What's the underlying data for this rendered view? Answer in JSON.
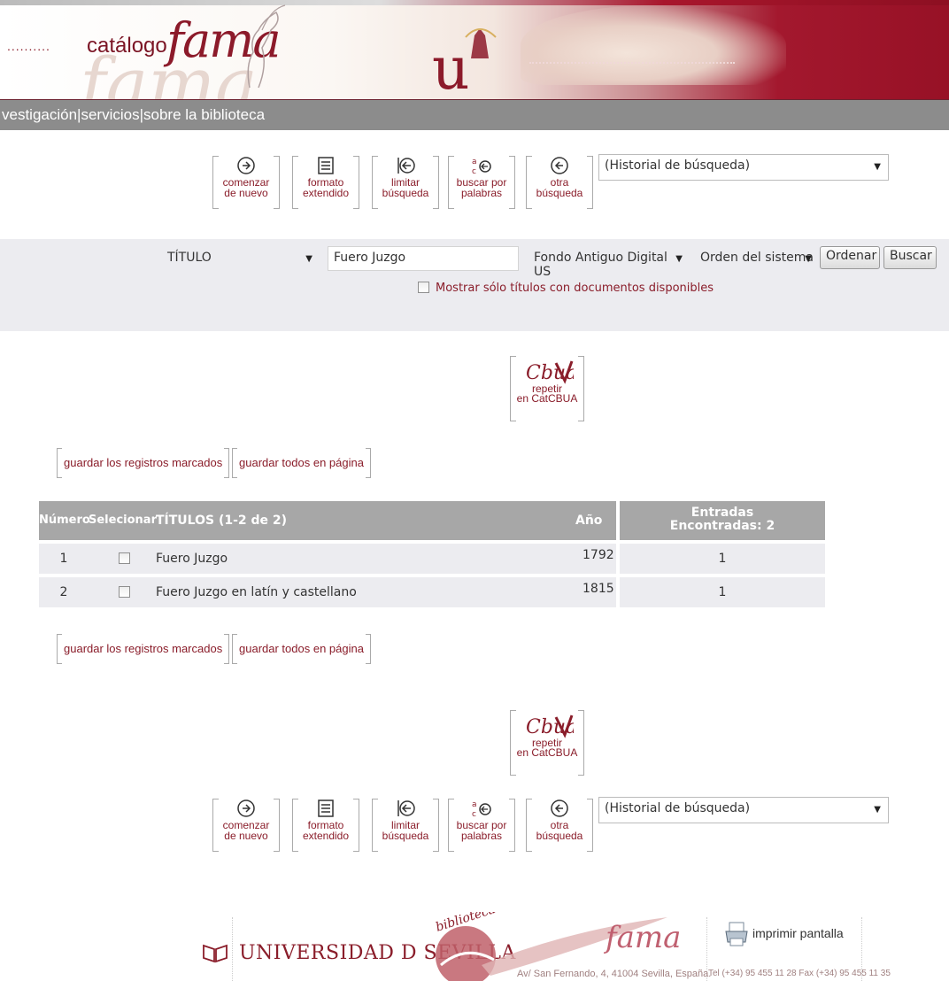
{
  "header": {
    "dots_left": "..........",
    "catalogo": "catálogo",
    "fama": "fama",
    "dots_right": "....................................................."
  },
  "nav": {
    "text": "vestigación|servicios|sobre la biblioteca"
  },
  "toolbar": {
    "buttons": [
      {
        "label": "comenzar\nde nuevo"
      },
      {
        "label": "formato\nextendido"
      },
      {
        "label": "limitar\nbúsqueda"
      },
      {
        "label": "buscar por\npalabras"
      },
      {
        "label": "otra\nbúsqueda"
      }
    ],
    "history_select": "(Historial de búsqueda)"
  },
  "search": {
    "field_select": "TÍTULO",
    "query_value": "Fuero Juzgo",
    "collection_select": "Fondo Antiguo Digital US",
    "order_select": "Orden del sistema",
    "sort_button": "Ordenar",
    "search_button": "Buscar",
    "only_available_label": "Mostrar sólo títulos con documentos disponibles"
  },
  "catcbua": {
    "label": "repetir\nen CatCBUA"
  },
  "save": {
    "marked": "guardar los registros marcados",
    "all_page": "guardar todos en página"
  },
  "table": {
    "headers": {
      "numero": "Número",
      "seleccionar": "Selecionar",
      "titulos": "TÍTULOS (1-2 de 2)",
      "ano": "Año",
      "entradas": "Entradas\nEncontradas: 2"
    },
    "rows": [
      {
        "num": "1",
        "title": "Fuero Juzgo",
        "year": "1792",
        "entries": "1"
      },
      {
        "num": "2",
        "title": "Fuero Juzgo en latín y castellano",
        "year": "1815",
        "entries": "1"
      }
    ]
  },
  "footer": {
    "university": "UNIVERSIDAD D SEVILLA",
    "biblioteca": "biblioteca",
    "fama": "fama",
    "print": "imprimir pantalla",
    "address": "Av/ San Fernando, 4, 41004 Sevilla, España.",
    "phone": "Tel (+34) 95 455 11 28 Fax (+34) 95 455 11 35"
  }
}
